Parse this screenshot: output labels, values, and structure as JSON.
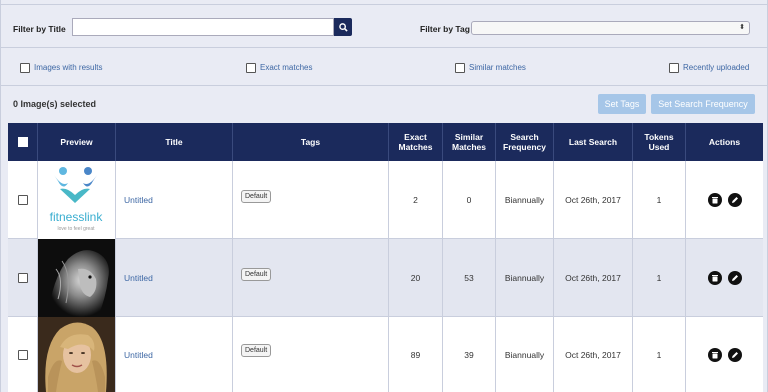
{
  "filters": {
    "title_label": "Filter by Title",
    "title_value": "",
    "tag_label": "Filter by Tag",
    "tag_value": ""
  },
  "checkboxes": [
    {
      "label": "Images with results",
      "checked": false
    },
    {
      "label": "Exact matches",
      "checked": false
    },
    {
      "label": "Similar matches",
      "checked": false
    },
    {
      "label": "Recently uploaded",
      "checked": false
    }
  ],
  "selection": {
    "text": "0 Image(s) selected",
    "set_tags": "Set Tags",
    "set_freq": "Set Search Frequency"
  },
  "table": {
    "headers": {
      "preview": "Preview",
      "title": "Title",
      "tags": "Tags",
      "exact": "Exact Matches",
      "similar": "Similar Matches",
      "frequency": "Search Frequency",
      "last": "Last Search",
      "tokens": "Tokens Used",
      "actions": "Actions"
    },
    "rows": [
      {
        "title": "Untitled",
        "tag": "Default",
        "exact": "2",
        "similar": "0",
        "frequency": "Biannually",
        "last": "Oct 26th, 2017",
        "tokens": "1",
        "preview": "fitnesslink-logo",
        "logo_text": "fitnesslink",
        "logo_tagline": "love to feel great"
      },
      {
        "title": "Untitled",
        "tag": "Default",
        "exact": "20",
        "similar": "53",
        "frequency": "Biannually",
        "last": "Oct 26th, 2017",
        "tokens": "1",
        "preview": "lion-photo"
      },
      {
        "title": "Untitled",
        "tag": "Default",
        "exact": "89",
        "similar": "39",
        "frequency": "Biannually",
        "last": "Oct 26th, 2017",
        "tokens": "1",
        "preview": "woman-portrait"
      }
    ]
  },
  "colors": {
    "header_bg": "#1b2a5c",
    "link": "#3d67a4",
    "button_light": "#a6c6e8"
  }
}
